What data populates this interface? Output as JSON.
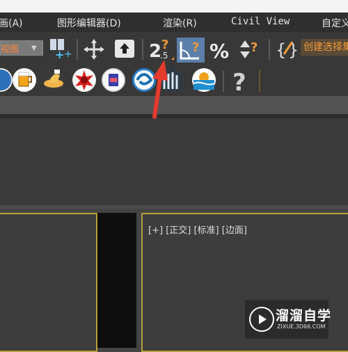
{
  "menubar": {
    "items": [
      {
        "name": "menu-animation",
        "label": "动画(A)"
      },
      {
        "name": "menu-graph-editors",
        "label": "图形编辑器(D)"
      },
      {
        "name": "menu-rendering",
        "label": "渲染(R)"
      },
      {
        "name": "menu-civil-view",
        "label": "Civil View"
      },
      {
        "name": "menu-customize",
        "label": "自定义"
      }
    ]
  },
  "toolbar": {
    "selection_filter": "视图",
    "named_selection_placeholder": "创建选择集",
    "icons": [
      "snap-icon",
      "move-icon",
      "upload-icon",
      "snap-25-icon",
      "angle-snap-icon",
      "percent-snap-icon",
      "spinner-snap-icon",
      "curly-brace-icon",
      "edit-named-selection-icon",
      "help-icon"
    ],
    "snap_25_label": "2",
    "snap_25_sub": ".5",
    "percent_label": "%",
    "help_label": "?"
  },
  "viewport": {
    "label_parts": [
      "[+]",
      "[正交]",
      "[标准]",
      "[边面]"
    ]
  },
  "watermark": {
    "title": "溜溜自学",
    "url": "ZIXUE.3D66.COM"
  },
  "colors": {
    "accent_orange": "#f09a3c",
    "viewport_border": "#b5a23a",
    "active_button_bg": "#5b7fa8",
    "arrow_red": "#e53a2e"
  }
}
